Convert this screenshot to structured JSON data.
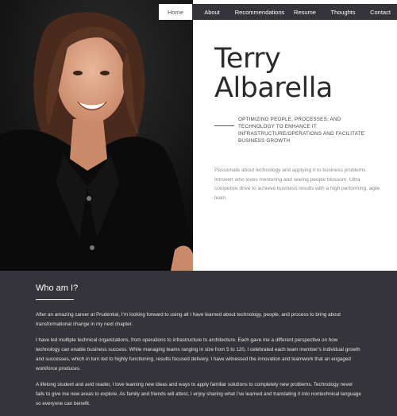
{
  "nav": {
    "items": [
      {
        "label": "Home"
      },
      {
        "label": "About"
      },
      {
        "label": "Recommendations"
      },
      {
        "label": "Resume"
      },
      {
        "label": "Thoughts"
      },
      {
        "label": "Contact"
      }
    ],
    "active": "Home"
  },
  "hero": {
    "first_name": "Terry",
    "last_name": "Albarella",
    "tagline": "OPTIMIZING PEOPLE, PROCESSES, AND TECHNOLOGY TO ENHANCE IT INFRASTRUCTURE/OPERATIONS AND FACILITATE BUSINESS GROWTH",
    "summary": "Passionate about technology and applying it to business problems. Introvert who loves mentoring and seeing people blossom. Ultra competive drive to achieve business results with a high performing, agile team."
  },
  "about": {
    "title": "Who am I?",
    "p1": "After an amazing career at Prudential, I’m looking forward to using all I have learned about technology, people, and process to bring about transformational change in my next chapter.",
    "p2": "I have led multiple technical organizations, from operations to infrastructure to architecture. Each gave me a different perspective on how technology can enable business success. While managing teams ranging in size from 5 to 120, I celebrated each team member’s individual growth and successes, which in turn led to highly functioning, results focused delivery. I have witnessed the innovation and teamwork that an engaged workforce produces.",
    "p3": "A lifelong student and avid reader, I love learning new ideas and ways to apply familiar solutions to completely new problems. Technology never fails to give me new areas to explore. As family and friends will attest, I enjoy sharing what I’ve learned and translating it into nontechnical language so everyone can benefit."
  },
  "colors": {
    "dark_band": "#35343a",
    "nav_active_bg": "#ffffff",
    "heading_text": "#2b2b2b"
  }
}
